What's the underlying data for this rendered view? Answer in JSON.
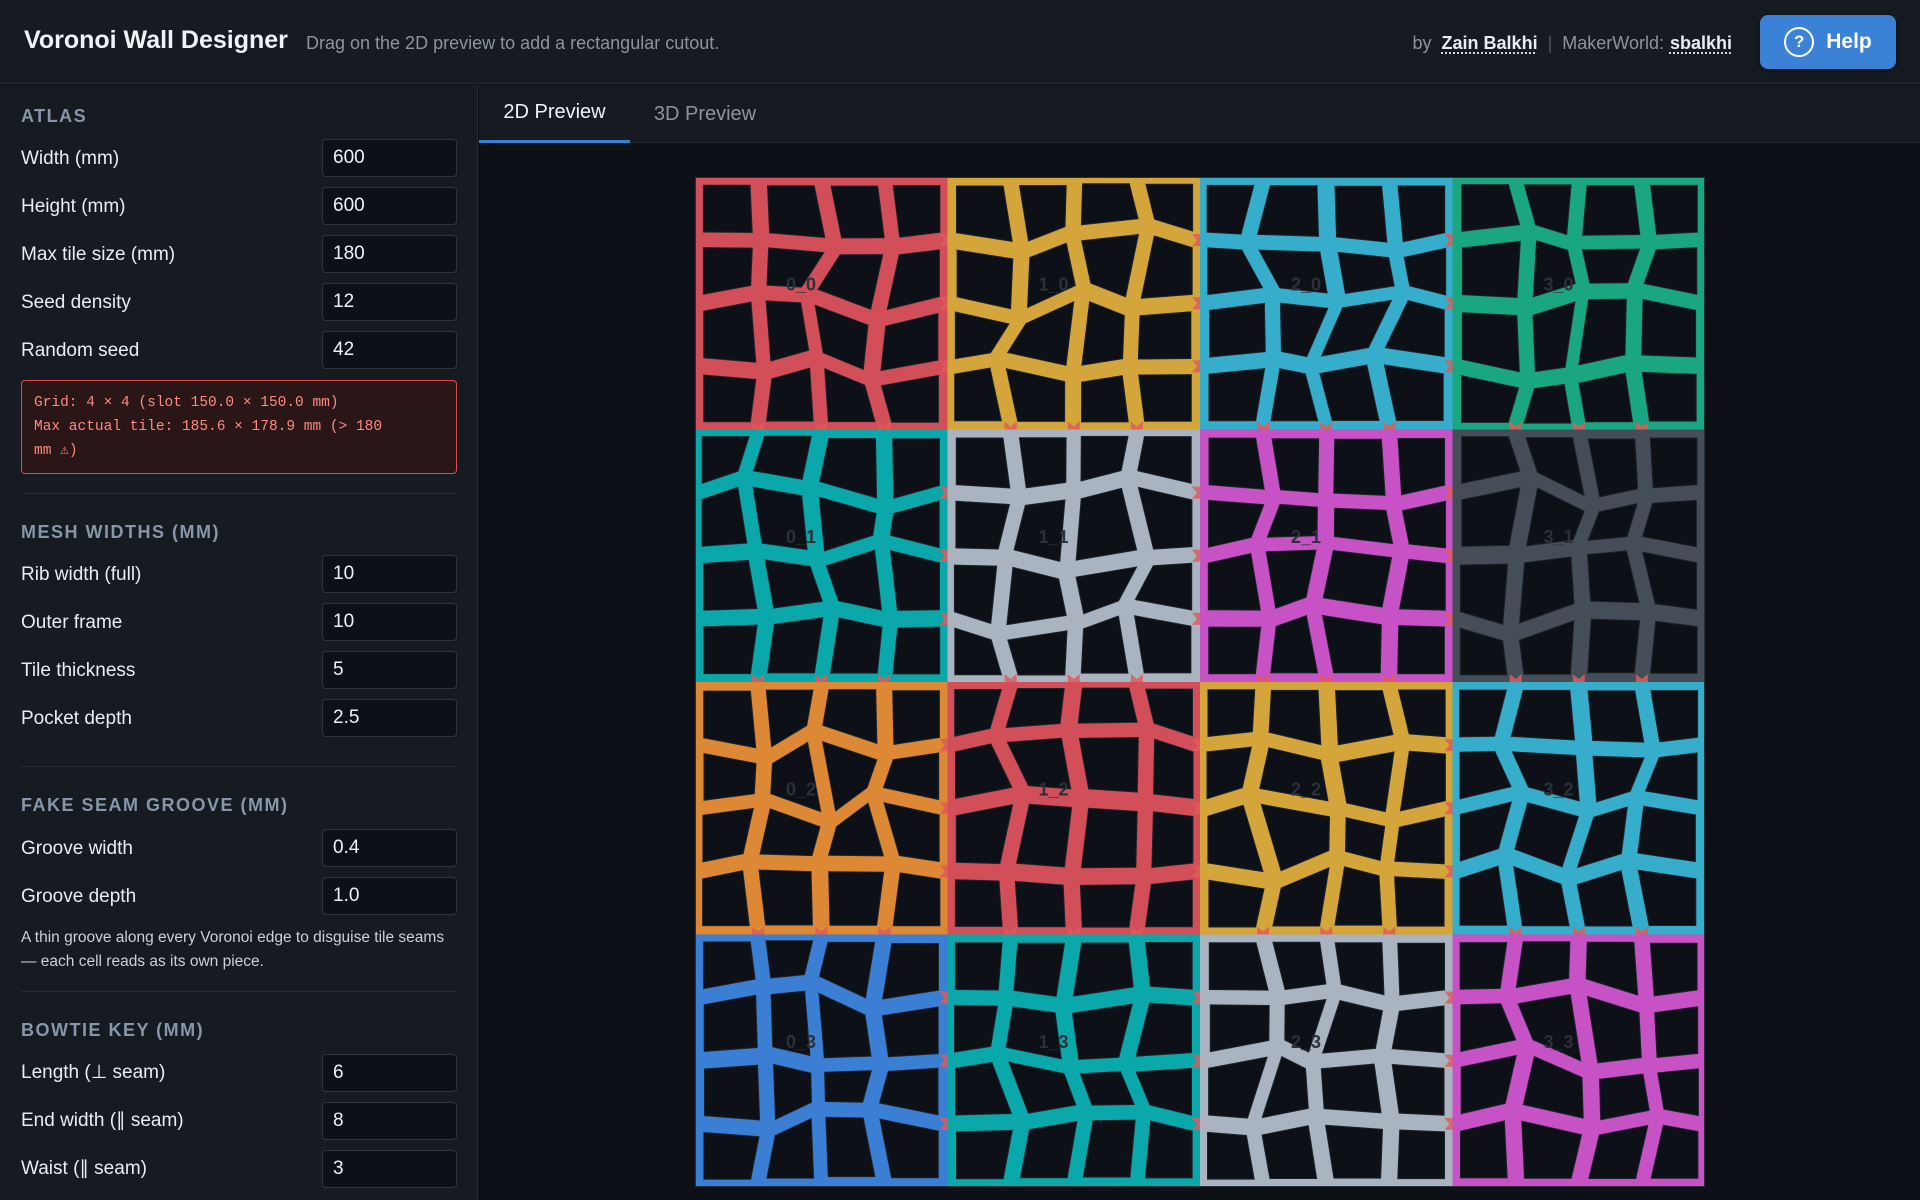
{
  "header": {
    "title": "Voronoi Wall Designer",
    "hint": "Drag on the 2D preview to add a rectangular cutout.",
    "by_prefix": "by",
    "author": "Zain Balkhi",
    "separator": "|",
    "makerworld_prefix": "MakerWorld:",
    "makerworld_handle": "sbalkhi",
    "help_label": "Help",
    "help_icon": "?"
  },
  "sidebar": {
    "atlas": {
      "title": "ATLAS",
      "width_label": "Width (mm)",
      "width_value": "600",
      "height_label": "Height (mm)",
      "height_value": "600",
      "max_tile_label": "Max tile size (mm)",
      "max_tile_value": "180",
      "seed_density_label": "Seed density",
      "seed_density_value": "12",
      "random_seed_label": "Random seed",
      "random_seed_value": "42",
      "warning_line1": "Grid: 4 × 4 (slot 150.0 × 150.0 mm)",
      "warning_line2": "Max actual tile: 185.6 × 178.9 mm (> 180",
      "warning_line3": "mm ⚠)"
    },
    "mesh": {
      "title": "MESH WIDTHS (MM)",
      "rib_label": "Rib width (full)",
      "rib_value": "10",
      "frame_label": "Outer frame",
      "frame_value": "10",
      "thickness_label": "Tile thickness",
      "thickness_value": "5",
      "pocket_label": "Pocket depth",
      "pocket_value": "2.5"
    },
    "groove": {
      "title": "FAKE SEAM GROOVE (MM)",
      "width_label": "Groove width",
      "width_value": "0.4",
      "depth_label": "Groove depth",
      "depth_value": "1.0",
      "note": "A thin groove along every Voronoi edge to disguise tile seams — each cell reads as its own piece."
    },
    "bowtie": {
      "title": "BOWTIE KEY (MM)",
      "length_label": "Length (⊥ seam)",
      "length_value": "6",
      "end_width_label": "End width (∥ seam)",
      "end_width_value": "8",
      "waist_label": "Waist (∥ seam)",
      "waist_value": "3"
    }
  },
  "tabs": [
    {
      "label": "2D Preview",
      "active": true
    },
    {
      "label": "3D Preview",
      "active": false
    }
  ],
  "preview": {
    "tiles": [
      {
        "label": "0_0",
        "color": "#d24e58"
      },
      {
        "label": "1_0",
        "color": "#d4a53a"
      },
      {
        "label": "2_0",
        "color": "#36aecb"
      },
      {
        "label": "3_0",
        "color": "#1aa680"
      },
      {
        "label": "0_1",
        "color": "#0aa7ab"
      },
      {
        "label": "1_1",
        "color": "#a9b4c0"
      },
      {
        "label": "2_1",
        "color": "#c752c5"
      },
      {
        "label": "3_1",
        "color": "#454e58"
      },
      {
        "label": "0_2",
        "color": "#dc8834"
      },
      {
        "label": "1_2",
        "color": "#d24e58"
      },
      {
        "label": "2_2",
        "color": "#d4a53a"
      },
      {
        "label": "3_2",
        "color": "#36aecb"
      },
      {
        "label": "0_3",
        "color": "#3a7fd4"
      },
      {
        "label": "1_3",
        "color": "#0aa7ab"
      },
      {
        "label": "2_3",
        "color": "#a9b4c0"
      },
      {
        "label": "3_3",
        "color": "#c752c5"
      }
    ],
    "key_color": "#e05a5a",
    "pocket_color": "#0d1117"
  }
}
